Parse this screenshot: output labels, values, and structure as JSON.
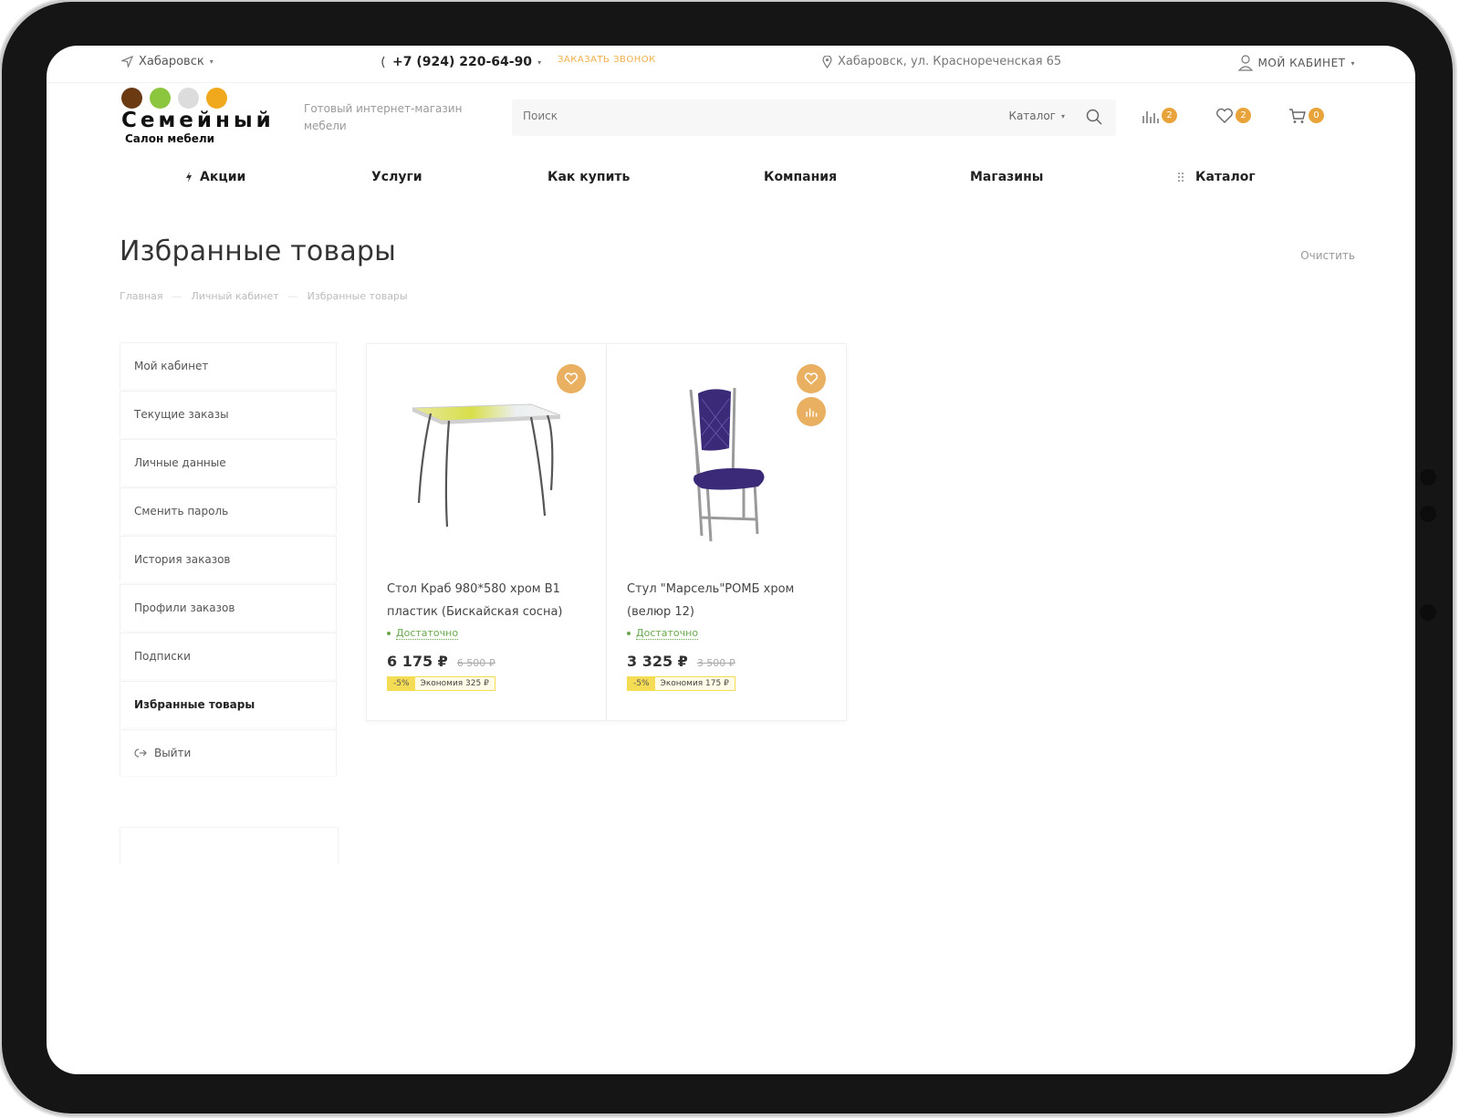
{
  "topbar": {
    "city": "Хабаровск",
    "phone": "+7 (924) 220-64-90",
    "callback": "ЗАКАЗАТЬ ЗВОНОК",
    "address": "Хабаровск, ул. Краснореченская 65",
    "cabinet": "МОЙ КАБИНЕТ"
  },
  "logo": {
    "name": "Семейный",
    "subtitle": "Салон мебели",
    "dot_colors": [
      "#6b3a12",
      "#8cc63f",
      "#dcdcdc",
      "#f0a91c"
    ]
  },
  "header": {
    "tagline": "Готовый интернет-магазин мебели",
    "search_placeholder": "Поиск",
    "search_scope": "Каталог",
    "compare_count": "2",
    "favorites_count": "2",
    "cart_count": "0"
  },
  "nav": {
    "items": [
      "Акции",
      "Услуги",
      "Как купить",
      "Компания",
      "Магазины",
      "Каталог"
    ]
  },
  "page": {
    "title": "Избранные товары",
    "clear": "Очистить",
    "breadcrumb": [
      "Главная",
      "Личный кабинет",
      "Избранные товары"
    ]
  },
  "sidebar": {
    "items": [
      "Мой кабинет",
      "Текущие заказы",
      "Личные данные",
      "Сменить пароль",
      "История заказов",
      "Профили заказов",
      "Подписки",
      "Избранные товары",
      "Выйти"
    ],
    "active_index": 7
  },
  "products": [
    {
      "name": "Стол Краб 980*580 хром В1 пластик (Бискайская сосна)",
      "stock": "Достаточно",
      "price": "6 175 ₽",
      "old_price": "6 500 ₽",
      "discount": "-5%",
      "saving": "Экономия 325 ₽"
    },
    {
      "name": "Стул \"Марсель\"РОМБ хром (велюр 12)",
      "stock": "Достаточно",
      "price": "3 325 ₽",
      "old_price": "3 500 ₽",
      "discount": "-5%",
      "saving": "Экономия 175 ₽"
    }
  ],
  "colors": {
    "accent": "#e8a43a",
    "stock_green": "#6aa84f",
    "discount_yellow": "#f5dc55"
  }
}
